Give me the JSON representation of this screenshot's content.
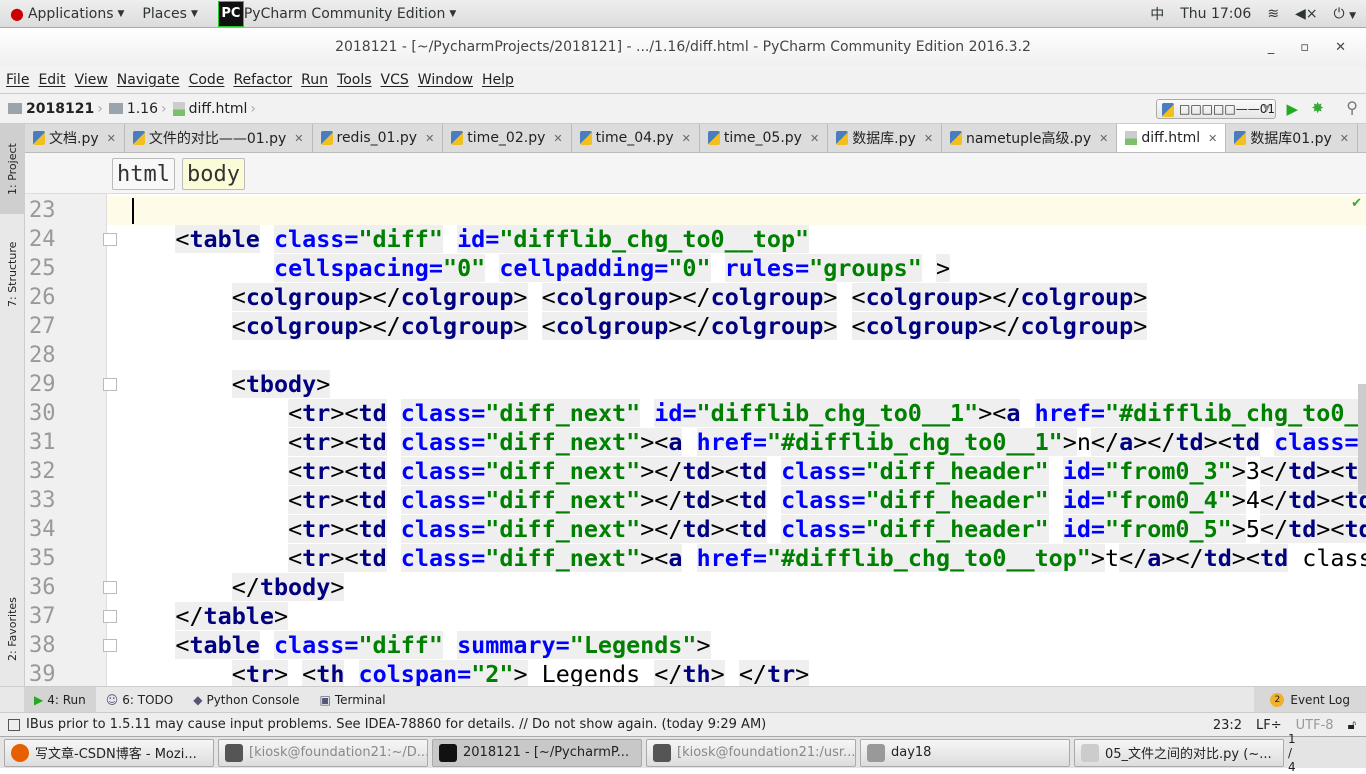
{
  "topbar": {
    "applications": "Applications",
    "places": "Places",
    "app": "PyCharm Community Edition",
    "logo": "PC",
    "input": "中",
    "clock": "Thu 17:06"
  },
  "window": {
    "title": "2018121 - [~/PycharmProjects/2018121] - .../1.16/diff.html - PyCharm Community Edition 2016.3.2"
  },
  "menu": [
    "File",
    "Edit",
    "View",
    "Navigate",
    "Code",
    "Refactor",
    "Run",
    "Tools",
    "VCS",
    "Window",
    "Help"
  ],
  "nav": {
    "crumbs": [
      "2018121",
      "1.16",
      "diff.html"
    ],
    "run_config": "□□□□□——01"
  },
  "tabs": [
    {
      "label": "文档.py",
      "icon": "python"
    },
    {
      "label": "文件的对比——01.py",
      "icon": "python"
    },
    {
      "label": "redis_01.py",
      "icon": "python"
    },
    {
      "label": "time_02.py",
      "icon": "python"
    },
    {
      "label": "time_04.py",
      "icon": "python"
    },
    {
      "label": "time_05.py",
      "icon": "python"
    },
    {
      "label": "数据库.py",
      "icon": "python"
    },
    {
      "label": "nametuple高级.py",
      "icon": "python"
    },
    {
      "label": "diff.html",
      "icon": "html",
      "active": true
    },
    {
      "label": "数据库01.py",
      "icon": "python"
    }
  ],
  "side": {
    "project": "1: Project",
    "structure": "7: Structure",
    "favorites": "2: Favorites"
  },
  "tag_breadcrumb": [
    "html",
    "body"
  ],
  "editor": {
    "first_line": 23,
    "current_line": 23,
    "lines": [
      "",
      "    <table class=\"diff\" id=\"difflib_chg_to0__top\"",
      "           cellspacing=\"0\" cellpadding=\"0\" rules=\"groups\" >",
      "        <colgroup></colgroup> <colgroup></colgroup> <colgroup></colgroup>",
      "        <colgroup></colgroup> <colgroup></colgroup> <colgroup></colgroup>",
      "",
      "        <tbody>",
      "            <tr><td class=\"diff_next\" id=\"difflib_chg_to0__1\"><a href=\"#difflib_chg_to0__",
      "            <tr><td class=\"diff_next\"><a href=\"#difflib_chg_to0__1\">n</a></td><td class=\"",
      "            <tr><td class=\"diff_next\"></td><td class=\"diff_header\" id=\"from0_3\">3</td><td",
      "            <tr><td class=\"diff_next\"></td><td class=\"diff_header\" id=\"from0_4\">4</td><td",
      "            <tr><td class=\"diff_next\"></td><td class=\"diff_header\" id=\"from0_5\">5</td><td",
      "            <tr><td class=\"diff_next\"><a href=\"#difflib_chg_to0__top\">t</a></td><td class",
      "        </tbody>",
      "    </table>",
      "    <table class=\"diff\" summary=\"Legends\">",
      "        <tr> <th colspan=\"2\"> Legends </th> </tr>"
    ],
    "fold_lines": [
      24,
      29,
      36,
      37,
      38
    ]
  },
  "toolwindows": [
    {
      "label": "4: Run",
      "icon": "run"
    },
    {
      "label": "6: TODO",
      "icon": "todo"
    },
    {
      "label": "Python Console",
      "icon": "python"
    },
    {
      "label": "Terminal",
      "icon": "terminal"
    }
  ],
  "event_log": {
    "label": "Event Log",
    "count": "2"
  },
  "status": {
    "message": "IBus prior to 1.5.11 may cause input problems. See IDEA-78860 for details. // Do not show again. (today 9:29 AM)",
    "position": "23:2",
    "line_sep": "LF÷",
    "encoding": "UTF-8"
  },
  "taskbar": [
    {
      "label": "写文章-CSDN博客 - Mozi...",
      "icon": "firefox"
    },
    {
      "label": "[kiosk@foundation21:~/D...",
      "icon": "terminal",
      "dim": true
    },
    {
      "label": "2018121 - [~/PycharmP...",
      "icon": "pycharm",
      "active": true
    },
    {
      "label": "[kiosk@foundation21:/usr...",
      "icon": "terminal",
      "dim": true
    },
    {
      "label": "day18",
      "icon": "files"
    },
    {
      "label": "05_文件之间的对比.py (~...",
      "icon": "editor"
    }
  ],
  "workspace": "1 / 4",
  "colors": {
    "tag": "#000080",
    "attr": "#0000ff",
    "string": "#008000",
    "current_line": "#fefbe8"
  }
}
